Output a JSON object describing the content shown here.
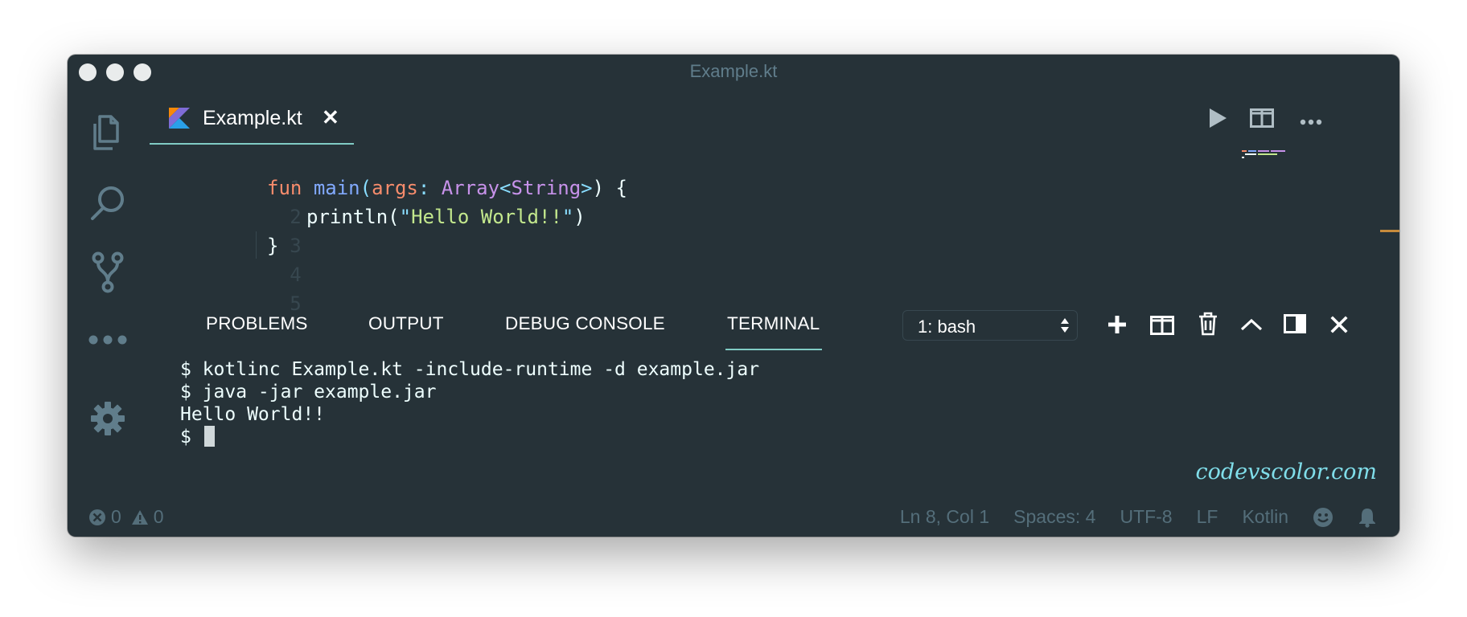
{
  "window": {
    "title": "Example.kt"
  },
  "activity_bar": {
    "icons": [
      "files-icon",
      "search-icon",
      "source-control-icon",
      "more-icon",
      "settings-gear-icon"
    ]
  },
  "editor": {
    "tab": {
      "label": "Example.kt",
      "close": "✕",
      "icon": "kotlin-logo-icon"
    },
    "actions": [
      "run-icon",
      "split-editor-icon",
      "more-actions-icon"
    ],
    "line_numbers": [
      "1",
      "2",
      "3",
      "4",
      "5"
    ],
    "code": {
      "line2": {
        "kw": "fun",
        "fn": "main",
        "p1": "(",
        "param": "args",
        "colon": ":",
        "t1": "Array",
        "lt": "<",
        "t2": "String",
        "gt": ">",
        "p2": ")",
        "brace": "{"
      },
      "line3": {
        "call": "println",
        "p1": "(",
        "q1": "\"",
        "str": "Hello World!!",
        "q2": "\"",
        "p2": ")"
      },
      "line4": {
        "brace": "}"
      }
    },
    "accent_colors": {
      "keyword": "#f78c6c",
      "function": "#82aaff",
      "type": "#c792ea",
      "string": "#c3e88d"
    }
  },
  "panel": {
    "tabs": [
      "PROBLEMS",
      "OUTPUT",
      "DEBUG CONSOLE",
      "TERMINAL"
    ],
    "active_tab": "TERMINAL",
    "terminal_select": {
      "value": "1: bash"
    },
    "actions": [
      "new-terminal-icon",
      "split-terminal-icon",
      "kill-terminal-icon",
      "maximize-panel-icon",
      "toggle-panel-position-icon",
      "close-panel-icon"
    ]
  },
  "terminal": {
    "lines": [
      "$ kotlinc Example.kt -include-runtime -d example.jar",
      "$ java -jar example.jar",
      "Hello World!!"
    ],
    "prompt": "$ "
  },
  "watermark": "codevscolor.com",
  "status_bar": {
    "errors": "0",
    "warnings": "0",
    "position": "Ln 8, Col 1",
    "spaces": "Spaces: 4",
    "encoding": "UTF-8",
    "eol": "LF",
    "language": "Kotlin"
  }
}
